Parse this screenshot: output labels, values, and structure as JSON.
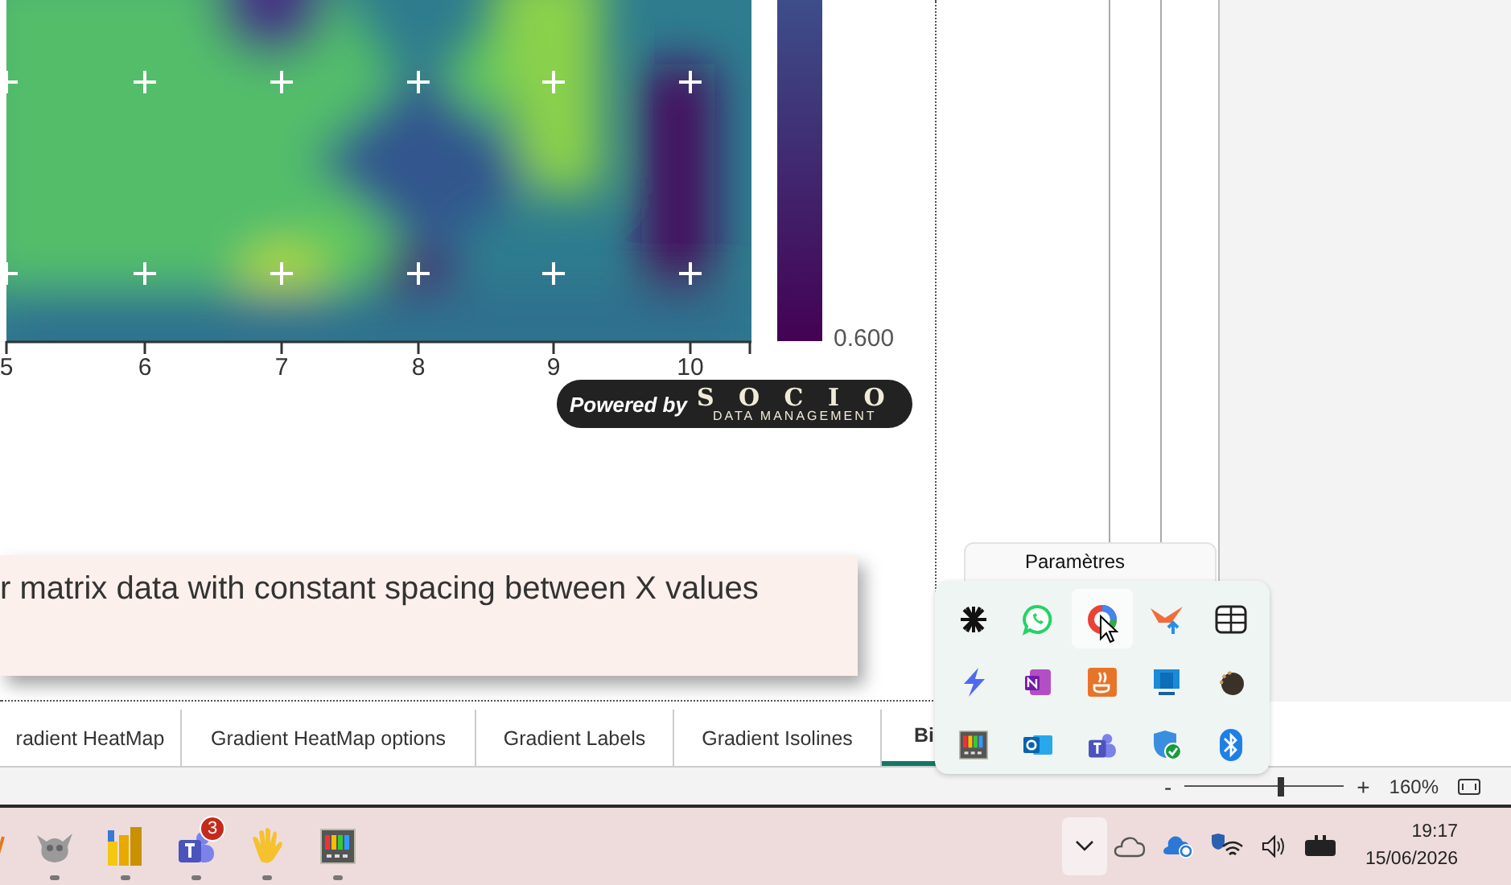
{
  "chart": {
    "x_ticks": [
      "5",
      "6",
      "7",
      "8",
      "9",
      "10"
    ],
    "colorbar_label": "0.600"
  },
  "badge": {
    "prefix": "Powered by",
    "brand": "S O C I O",
    "tagline": "DATA MANAGEMENT"
  },
  "note": "r matrix data with constant spacing between X values",
  "tabs": [
    {
      "label": "radient HeatMap",
      "selected": false
    },
    {
      "label": "Gradient HeatMap options",
      "selected": false
    },
    {
      "label": "Gradient Labels",
      "selected": false
    },
    {
      "label": "Gradient Isolines",
      "selected": false
    },
    {
      "label": "Bi",
      "selected": true
    }
  ],
  "zoom": {
    "minus": "-",
    "plus": "+",
    "level": 0.6,
    "reading": "160%"
  },
  "tray_popup": {
    "tooltip": "Paramètres",
    "icons": [
      {
        "hovered": false
      },
      {
        "hovered": false
      },
      {
        "hovered": true
      },
      {
        "hovered": false
      },
      {
        "hovered": false
      },
      {
        "hovered": false
      },
      {
        "hovered": false
      },
      {
        "hovered": false
      },
      {
        "hovered": false
      },
      {
        "hovered": false
      },
      {
        "hovered": false
      },
      {
        "hovered": false
      },
      {
        "hovered": false
      },
      {
        "hovered": false
      },
      {
        "hovered": false
      }
    ]
  },
  "taskbar": {
    "apps": [
      {
        "running": false
      },
      {
        "running": true
      },
      {
        "running": true
      },
      {
        "running": true,
        "badge": "3"
      },
      {
        "running": true
      },
      {
        "running": true
      }
    ],
    "tray_toggle": {
      "expanded": true
    },
    "time": "19:17",
    "date": "15/06/2026"
  }
}
